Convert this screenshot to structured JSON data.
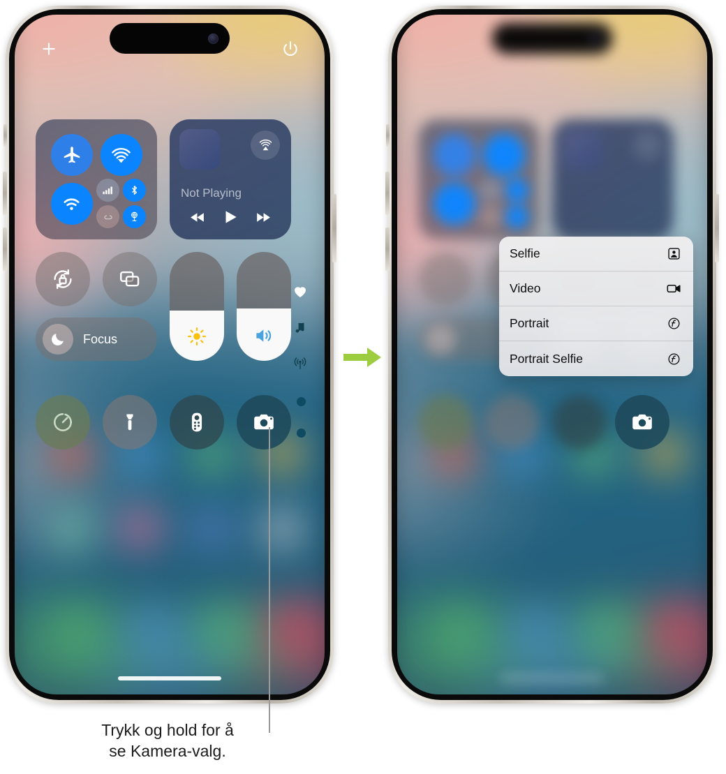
{
  "caption": {
    "line1": "Trykk og hold for å",
    "line2": "se Kamera-valg."
  },
  "arrow": {
    "name": "flow-arrow",
    "color": "#9ccc3f"
  },
  "phones": {
    "left": {
      "name": "iphone-control-center",
      "state": "control-center-open"
    },
    "right": {
      "name": "iphone-camera-options",
      "state": "camera-quick-actions-open"
    }
  },
  "control_center": {
    "top_left_icon": "plus-icon",
    "top_right_icon": "power-icon",
    "connectivity": {
      "airplane": {
        "label": "Airplane Mode",
        "icon": "airplane-icon",
        "on": false
      },
      "airdrop": {
        "label": "AirDrop",
        "icon": "airdrop-icon",
        "on": true
      },
      "wifi": {
        "label": "Wi-Fi",
        "icon": "wifi-icon",
        "on": true
      },
      "cellular": {
        "label": "Cellular Data",
        "icon": "cellular-bars-icon",
        "on": false
      },
      "bluetooth": {
        "label": "Bluetooth",
        "icon": "bluetooth-icon",
        "on": true
      },
      "hotspot": {
        "label": "Personal Hotspot",
        "icon": "hotspot-icon",
        "on": false
      },
      "vpn": {
        "label": "VPN",
        "icon": "vpn-globe-icon",
        "on": true
      }
    },
    "media": {
      "title": "Not Playing",
      "airplay_icon": "airplay-audio-icon",
      "artwork": "album-art-placeholder",
      "rewind_icon": "rewind-icon",
      "play_icon": "play-icon",
      "forward_icon": "fast-forward-icon"
    },
    "toggles": {
      "rotation_lock": {
        "label": "Rotation Lock",
        "icon": "rotation-lock-icon"
      },
      "screen_mirroring": {
        "label": "Screen Mirroring",
        "icon": "screen-mirroring-icon"
      }
    },
    "focus": {
      "label": "Focus",
      "icon": "moon-icon"
    },
    "sliders": {
      "brightness": {
        "label": "Brightness",
        "icon": "sun-icon",
        "value_percent": 46
      },
      "volume": {
        "label": "Volume",
        "icon": "speaker-wave-icon",
        "value_percent": 48
      }
    },
    "bottom_buttons": [
      {
        "name": "timer-button",
        "label": "Timer",
        "icon": "timer-icon"
      },
      {
        "name": "flashlight-button",
        "label": "Flashlight",
        "icon": "flashlight-icon"
      },
      {
        "name": "remote-button",
        "label": "Apple TV Remote",
        "icon": "remote-icon"
      },
      {
        "name": "camera-button",
        "label": "Camera",
        "icon": "camera-icon"
      }
    ],
    "rail_icons": [
      {
        "name": "favorites-icon",
        "label": "Favorites"
      },
      {
        "name": "music-note-icon",
        "label": "Now Playing"
      },
      {
        "name": "broadcast-icon",
        "label": "Connectivity"
      }
    ],
    "page_dots": 2
  },
  "camera_menu": {
    "name": "camera-quick-actions-menu",
    "items": [
      {
        "label": "Selfie",
        "icon": "selfie-person-icon"
      },
      {
        "label": "Video",
        "icon": "video-camera-icon"
      },
      {
        "label": "Portrait",
        "icon": "f-stop-icon"
      },
      {
        "label": "Portrait Selfie",
        "icon": "f-stop-icon"
      }
    ]
  }
}
